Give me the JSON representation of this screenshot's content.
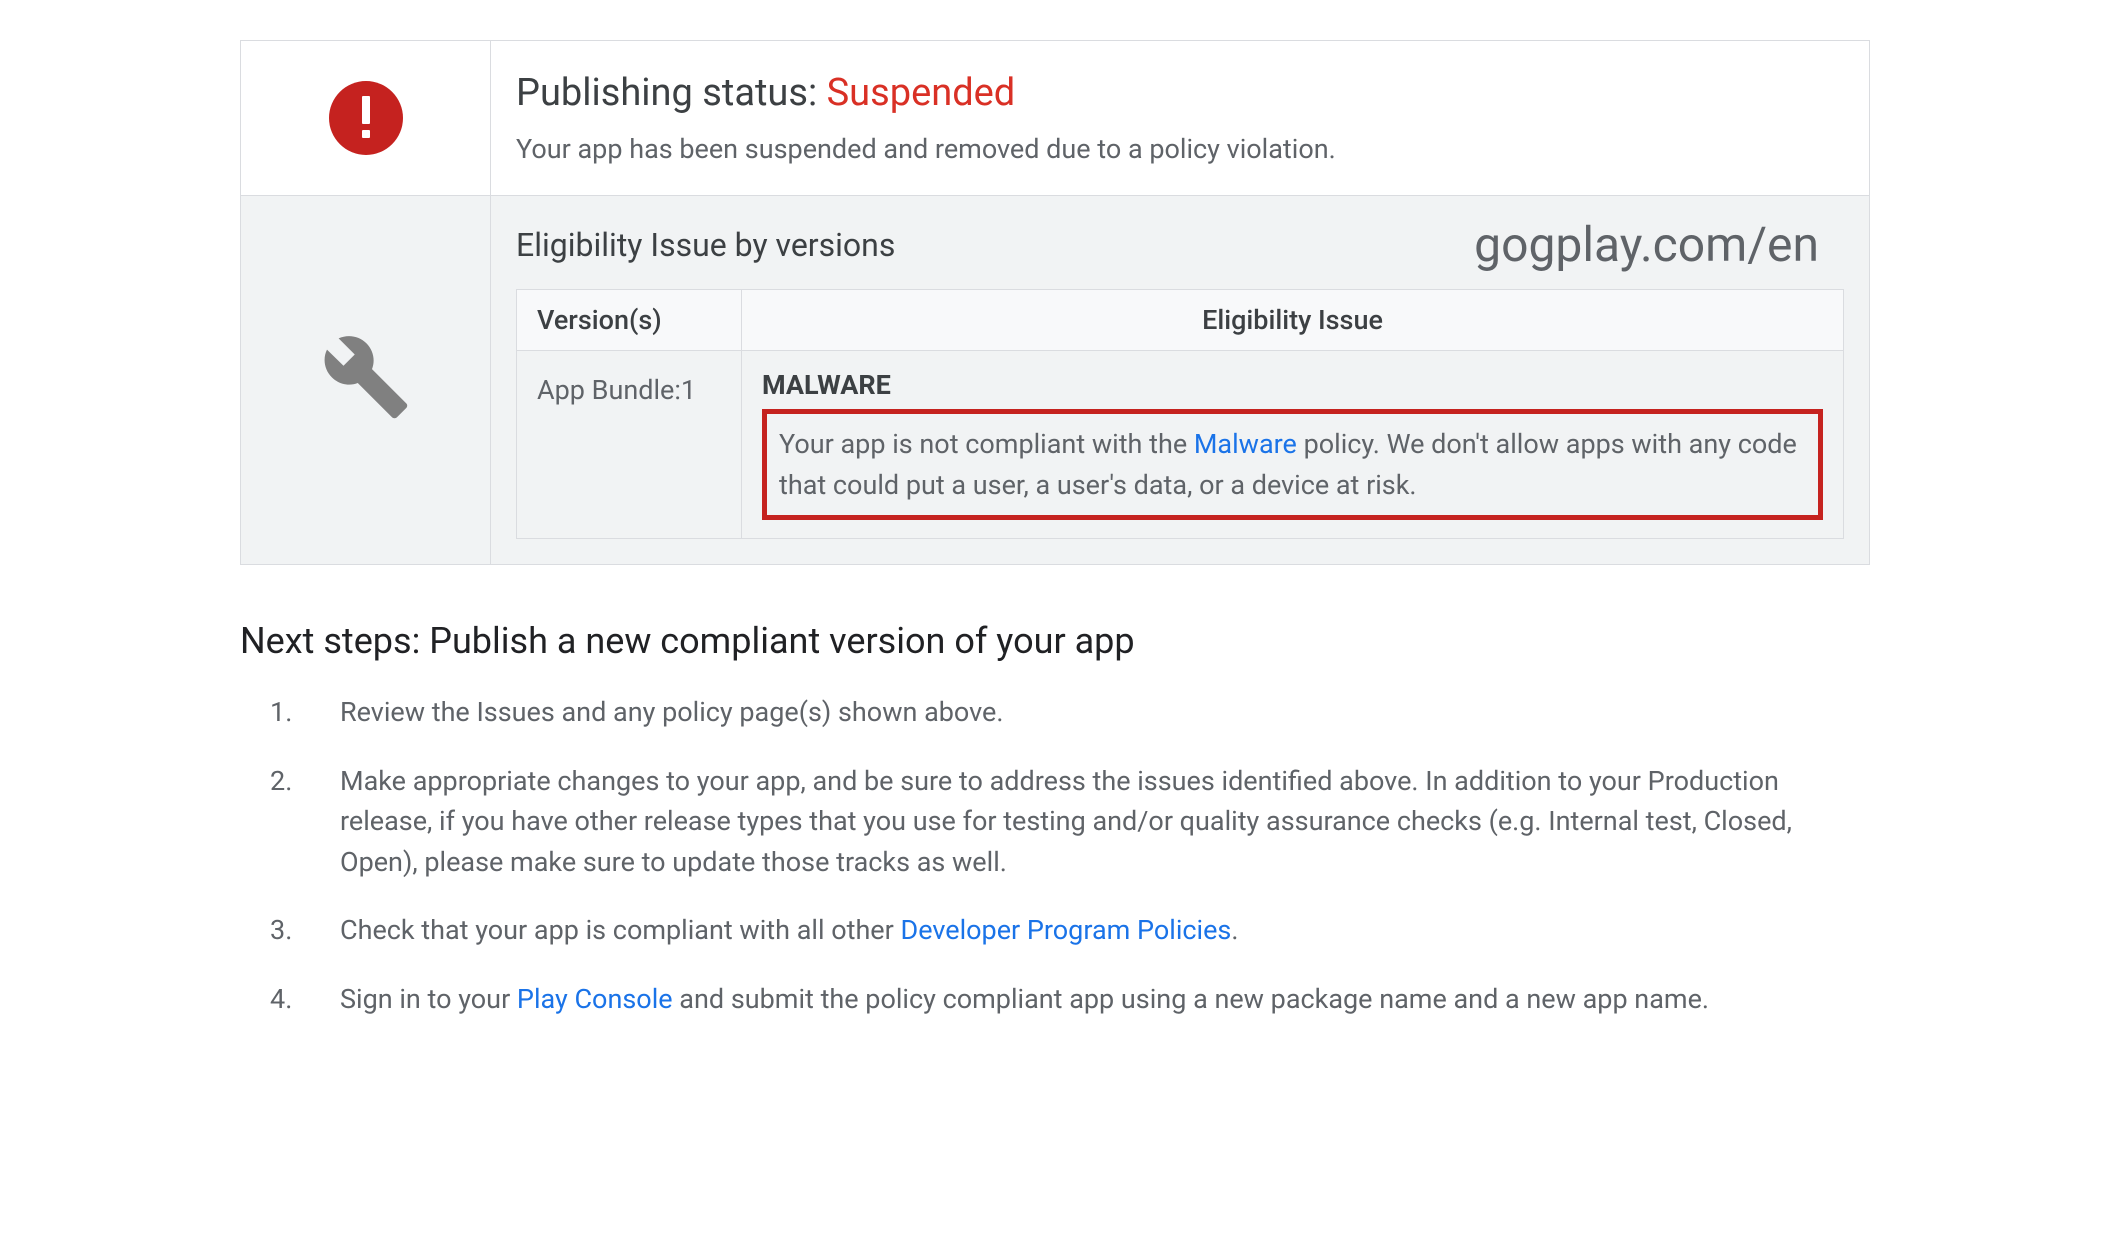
{
  "status": {
    "label": "Publishing status: ",
    "value": "Suspended",
    "description": "Your app has been suspended and removed due to a policy violation."
  },
  "watermark": "gogplay.com/en",
  "issues": {
    "heading": "Eligibility Issue by versions",
    "columns": {
      "version": "Version(s)",
      "issue": "Eligibility Issue"
    },
    "row": {
      "version": "App Bundle:1",
      "title": "MALWARE",
      "desc_prefix": "Your app is not compliant with the ",
      "policy_link": "Malware",
      "desc_suffix": " policy. We don't allow apps with any code that could put a user, a user's data, or a device at risk."
    }
  },
  "next_steps": {
    "heading": "Next steps: Publish a new compliant version of your app",
    "items": {
      "s1": "Review the Issues and any policy page(s) shown above.",
      "s2": "Make appropriate changes to your app, and be sure to address the issues identified above. In addition to your Production release, if you have other release types that you use for testing and/or quality assurance checks (e.g. Internal test, Closed, Open), please make sure to update those tracks as well.",
      "s3_prefix": "Check that your app is compliant with all other ",
      "s3_link": "Developer Program Policies",
      "s3_suffix": ".",
      "s4_prefix": "Sign in to your ",
      "s4_link": "Play Console",
      "s4_suffix": " and submit the policy compliant app using a new package name and a new app name."
    }
  }
}
